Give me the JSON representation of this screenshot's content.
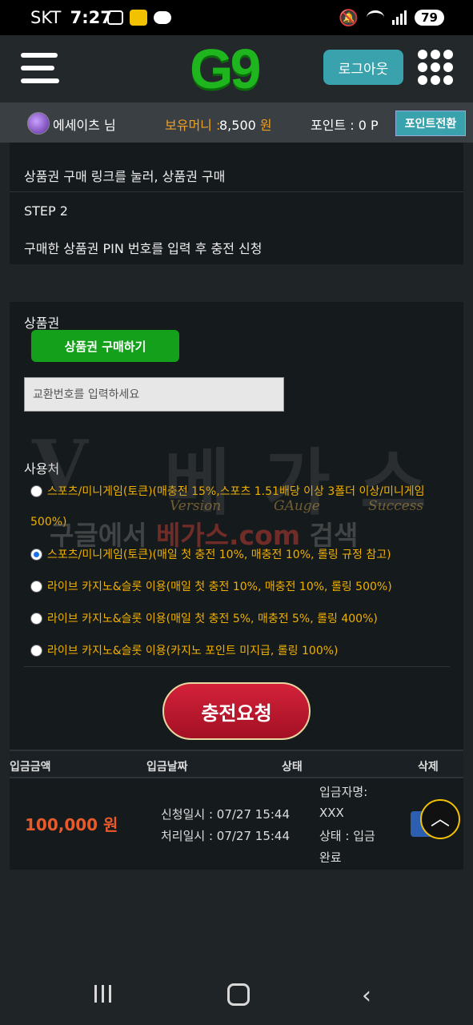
{
  "status_bar": {
    "carrier": "SKT",
    "time": "7:27",
    "battery": "79"
  },
  "header": {
    "logo": "G9",
    "logout_label": "로그아웃"
  },
  "user_bar": {
    "username": "에세이츠 님",
    "money_label": "보유머니 :",
    "money_value": "8,500",
    "money_unit": "원",
    "point_text": "포인트 : 0 P",
    "point_convert_label": "포인트전환"
  },
  "steps": {
    "step1_desc": "상품권 구매 링크를 눌러, 상품권 구매",
    "step2_title": "STEP 2",
    "step2_desc": "구매한 상품권 PIN 번호를 입력 후 충전 신청"
  },
  "form": {
    "gift_label": "상품권",
    "buy_button": "상품권 구매하기",
    "code_placeholder": "교환번호를 입력하세요",
    "usage_label": "사용처",
    "options": [
      {
        "label": "스포츠/미니게임(토큰)(매충전 15%,스포츠 1.51배당 이상 3폴더 이상/미니게임 500%)",
        "selected": false
      },
      {
        "label": "스포츠/미니게임(토큰)(매일 첫 충전 10%, 매충전 10%, 롤링 규정 참고)",
        "selected": true
      },
      {
        "label": "라이브 카지노&슬롯 이용(매일 첫 충전 10%, 매충전 10%, 롤링 500%)",
        "selected": false
      },
      {
        "label": "라이브 카지노&슬롯 이용(매일 첫 충전 5%, 매충전 5%, 롤링 400%)",
        "selected": false
      },
      {
        "label": "라이브 카지노&슬롯 이용(카지노 포인트 미지급, 롤링 100%)",
        "selected": false
      }
    ],
    "charge_button": "충전요청"
  },
  "watermark": {
    "big1": "V",
    "big2": "베",
    "big3": "가",
    "big4": "스",
    "sub1": "Version",
    "sub2": "GAuge",
    "sub3": "Success",
    "search_a": "구글에서 ",
    "search_b": "베가스.com",
    "search_c": " 검색"
  },
  "table": {
    "headers": [
      "입금금액",
      "입금날짜",
      "상태",
      "삭제"
    ],
    "row": {
      "amount": "100,000 원",
      "request_time": "신청일시 : 07/27 15:44",
      "process_time": "처리일시 : 07/27 15:44",
      "status_line1": "입금자명:",
      "status_line2": "XXX",
      "status_line3": "상태 : 입금",
      "status_line4": "완료"
    }
  },
  "icons": {
    "scroll_top": "chevron-up-icon",
    "menu": "hamburger-icon",
    "apps": "grid-icon"
  },
  "colors": {
    "accent_teal": "#3aa2ac",
    "green": "#14a01a",
    "orange": "#f0a020",
    "red_button": "#c0182e"
  }
}
